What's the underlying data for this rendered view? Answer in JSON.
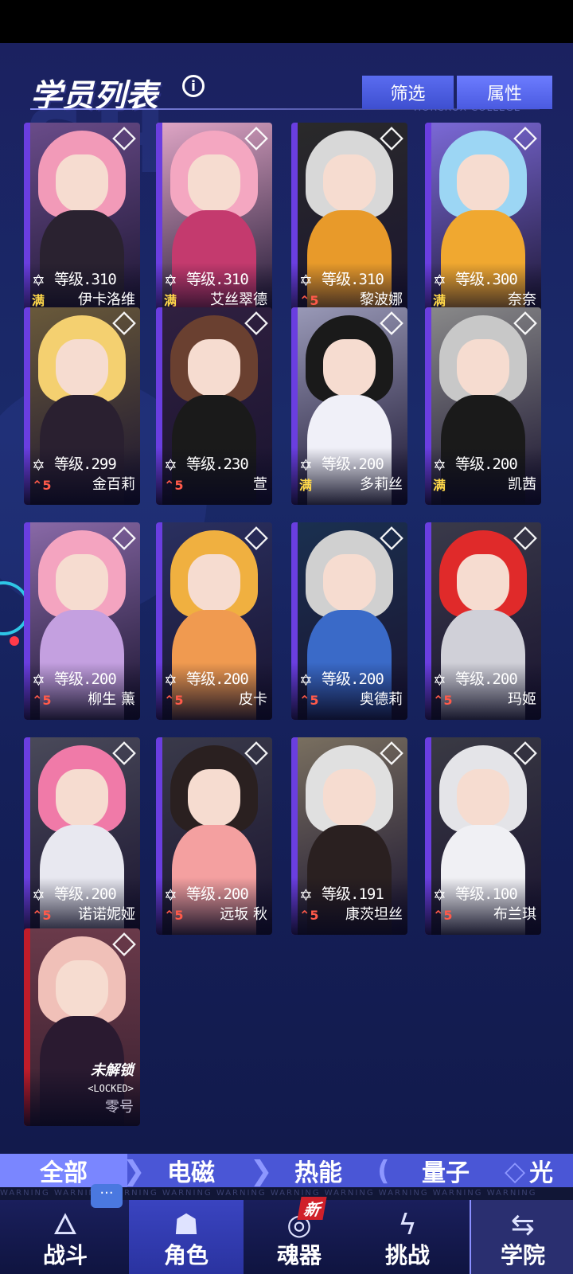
{
  "header": {
    "title": "学员列表",
    "info_icon": "info-icon",
    "filter_button": "筛选",
    "attribute_button": "属性",
    "watermark": "HORCRUX COLLEGE"
  },
  "students": [
    {
      "name": "伊卡洛维",
      "level": "等级.310",
      "rank": "满",
      "element": "diamond-icon",
      "colors": {
        "hair": "#f29ab8",
        "body": "#2a2230",
        "bg": "#6a4c8a"
      }
    },
    {
      "name": "艾丝翠德",
      "level": "等级.310",
      "rank": "满",
      "element": "diamond-icon",
      "colors": {
        "hair": "#f4a7c1",
        "body": "#c43a6e",
        "bg": "#e0a6c6"
      }
    },
    {
      "name": "黎波娜",
      "level": "等级.310",
      "rank": "5",
      "element": "diamond-icon",
      "colors": {
        "hair": "#d8d8d8",
        "body": "#e89a2a",
        "bg": "#2a2a2a"
      }
    },
    {
      "name": "奈奈",
      "level": "等级.300",
      "rank": "满",
      "element": "diamond-icon",
      "colors": {
        "hair": "#9cd6f4",
        "body": "#f0a830",
        "bg": "#7c6ad8"
      }
    },
    {
      "name": "金百莉",
      "level": "等级.299",
      "rank": "5",
      "element": "diamond-icon",
      "colors": {
        "hair": "#f4d070",
        "body": "#2a2030",
        "bg": "#6a5a3a"
      }
    },
    {
      "name": "萱",
      "level": "等级.230",
      "rank": "5",
      "element": "bars-icon",
      "colors": {
        "hair": "#6a4030",
        "body": "#1a1a1a",
        "bg": "#302040"
      }
    },
    {
      "name": "多莉丝",
      "level": "等级.200",
      "rank": "满",
      "element": "diamond-icon",
      "colors": {
        "hair": "#1a1a1a",
        "body": "#f0f0f8",
        "bg": "#9a9ab8"
      }
    },
    {
      "name": "凯茜",
      "level": "等级.200",
      "rank": "满",
      "element": "diamond-icon",
      "colors": {
        "hair": "#c8c8c8",
        "body": "#1a1a1a",
        "bg": "#8a8a8a"
      }
    },
    {
      "name": "柳生 薰",
      "level": "等级.200",
      "rank": "5",
      "element": "triangle-icon",
      "colors": {
        "hair": "#f4a4c0",
        "body": "#c4a0e0",
        "bg": "#8a6aa8"
      }
    },
    {
      "name": "皮卡",
      "level": "等级.200",
      "rank": "5",
      "element": "wifi-icon",
      "colors": {
        "hair": "#f0b040",
        "body": "#f09a50",
        "bg": "#2a3060"
      }
    },
    {
      "name": "奥德莉",
      "level": "等级.200",
      "rank": "5",
      "element": "wifi-icon",
      "colors": {
        "hair": "#d0d0d0",
        "body": "#3a6ac8",
        "bg": "#1a3050"
      }
    },
    {
      "name": "玛姬",
      "level": "等级.200",
      "rank": "5",
      "element": "circle-icon",
      "colors": {
        "hair": "#e02a2a",
        "body": "#d0d0d8",
        "bg": "#3a3a4a"
      }
    },
    {
      "name": "诺诺妮娅",
      "level": "等级.200",
      "rank": "5",
      "element": "circle-icon",
      "colors": {
        "hair": "#f07aa8",
        "body": "#e8e8f0",
        "bg": "#4a4a5a"
      }
    },
    {
      "name": "远坂 秋",
      "level": "等级.200",
      "rank": "5",
      "element": "bars-icon",
      "colors": {
        "hair": "#2a2020",
        "body": "#f4a0a0",
        "bg": "#3a3a4a"
      }
    },
    {
      "name": "康茨坦丝",
      "level": "等级.191",
      "rank": "5",
      "element": "bars-icon",
      "colors": {
        "hair": "#e0e0e0",
        "body": "#2a2020",
        "bg": "#7a7060"
      }
    },
    {
      "name": "布兰琪",
      "level": "等级.100",
      "rank": "5",
      "element": "diamond-icon",
      "colors": {
        "hair": "#e4e4e8",
        "body": "#f0f0f4",
        "bg": "#3a3a44"
      }
    }
  ],
  "locked_student": {
    "status": "未解锁",
    "sub": "<LOCKED>",
    "name": "零号",
    "element": "triangle-icon"
  },
  "filter_tabs": [
    {
      "label": "全部"
    },
    {
      "label": "电磁"
    },
    {
      "label": "热能"
    },
    {
      "label": "量子"
    },
    {
      "label": "光"
    }
  ],
  "warning_strip": "WARNING WARNING WARNING WARNING WARNING WARNING WARNING WARNING WARNING WARNING",
  "nav": {
    "battle": "战斗",
    "character": "角色",
    "soul": "魂器",
    "challenge": "挑战",
    "college": "学院",
    "new_badge": "新",
    "chat_icon": "chat-icon"
  },
  "rank_up_symbol": "⌃"
}
